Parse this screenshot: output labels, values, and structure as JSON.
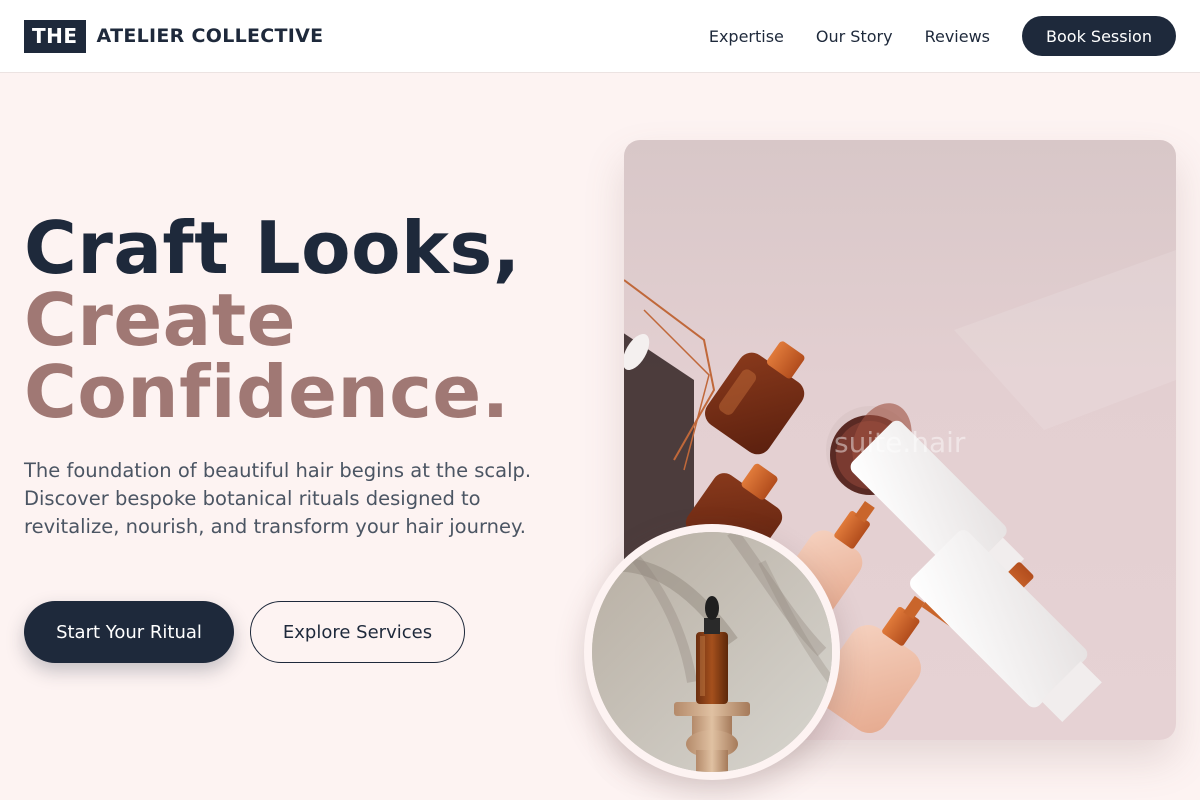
{
  "header": {
    "logo_box": "THE",
    "logo_text": "ATELIER COLLECTIVE",
    "nav": [
      {
        "label": "Expertise"
      },
      {
        "label": "Our Story"
      },
      {
        "label": "Reviews"
      }
    ],
    "cta_label": "Book Session"
  },
  "hero": {
    "title_line1": "Craft Looks,",
    "title_line2": "Create",
    "title_line3": "Confidence.",
    "description": "The foundation of beautiful hair begins at the scalp. Discover bespoke botanical rituals designed to revitalize, nourish, and transform your hair journey.",
    "primary_button": "Start Your Ritual",
    "secondary_button": "Explore Services"
  },
  "image": {
    "watermark": "suite.hair"
  },
  "colors": {
    "navy": "#1e293b",
    "mauve": "#a07874",
    "background": "#fdf3f2"
  }
}
